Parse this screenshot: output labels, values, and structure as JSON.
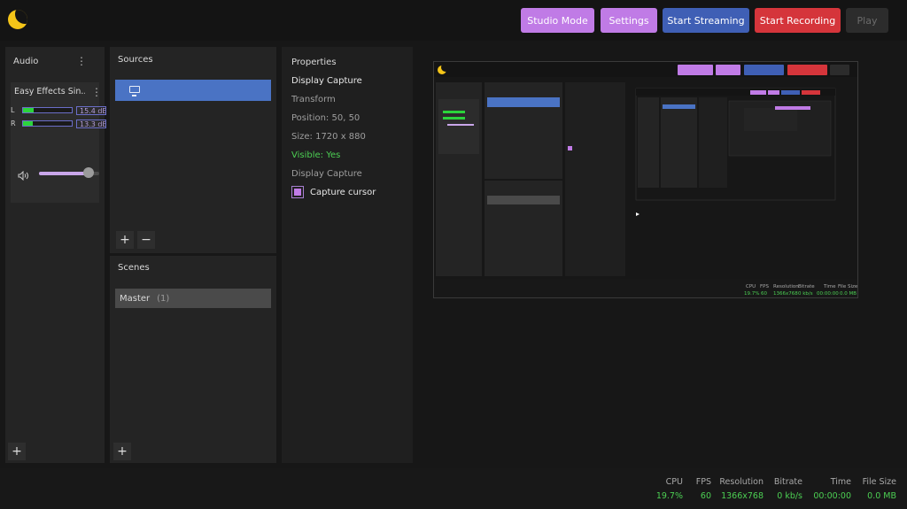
{
  "toolbar": {
    "studio_mode": "Studio Mode",
    "settings": "Settings",
    "start_streaming": "Start Streaming",
    "start_recording": "Start Recording",
    "play": "Play"
  },
  "audio": {
    "title": "Audio",
    "menu_icon": "kebab-icon",
    "item": {
      "name": "Easy Effects Sin...",
      "left_label": "L",
      "left_db": "15.4 dB",
      "left_level": 0.22,
      "right_label": "R",
      "right_db": "13.3 dB",
      "right_level": 0.2,
      "volume": 0.82
    },
    "add": "+"
  },
  "sources": {
    "title": "Sources",
    "items": [
      {
        "icon": "monitor-icon"
      }
    ],
    "add": "+",
    "remove": "−"
  },
  "scenes": {
    "title": "Scenes",
    "items": [
      {
        "name": "Master",
        "count": "(1)"
      }
    ],
    "add": "+"
  },
  "properties": {
    "title": "Properties",
    "source_name": "Display Capture",
    "transform": "Transform",
    "position": "Position: 50, 50",
    "size": "Size: 1720 x 880",
    "visible": "Visible: Yes",
    "section": "Display Capture",
    "capture_cursor": "Capture cursor",
    "capture_cursor_checked": true
  },
  "status": {
    "cpu_label": "CPU",
    "cpu_value": "19.7%",
    "fps_label": "FPS",
    "fps_value": "60",
    "resolution_label": "Resolution",
    "resolution_value": "1366x768",
    "bitrate_label": "Bitrate",
    "bitrate_value": "0 kb/s",
    "time_label": "Time",
    "time_value": "00:00:00",
    "filesize_label": "File Size",
    "filesize_value": "0.0 MB"
  },
  "colors": {
    "accent": "#c07be6",
    "stream": "#3f5fb5",
    "record": "#d5353b",
    "selected_source": "#4a73c4",
    "green": "#4ccf53",
    "logo": "#f5c518"
  }
}
